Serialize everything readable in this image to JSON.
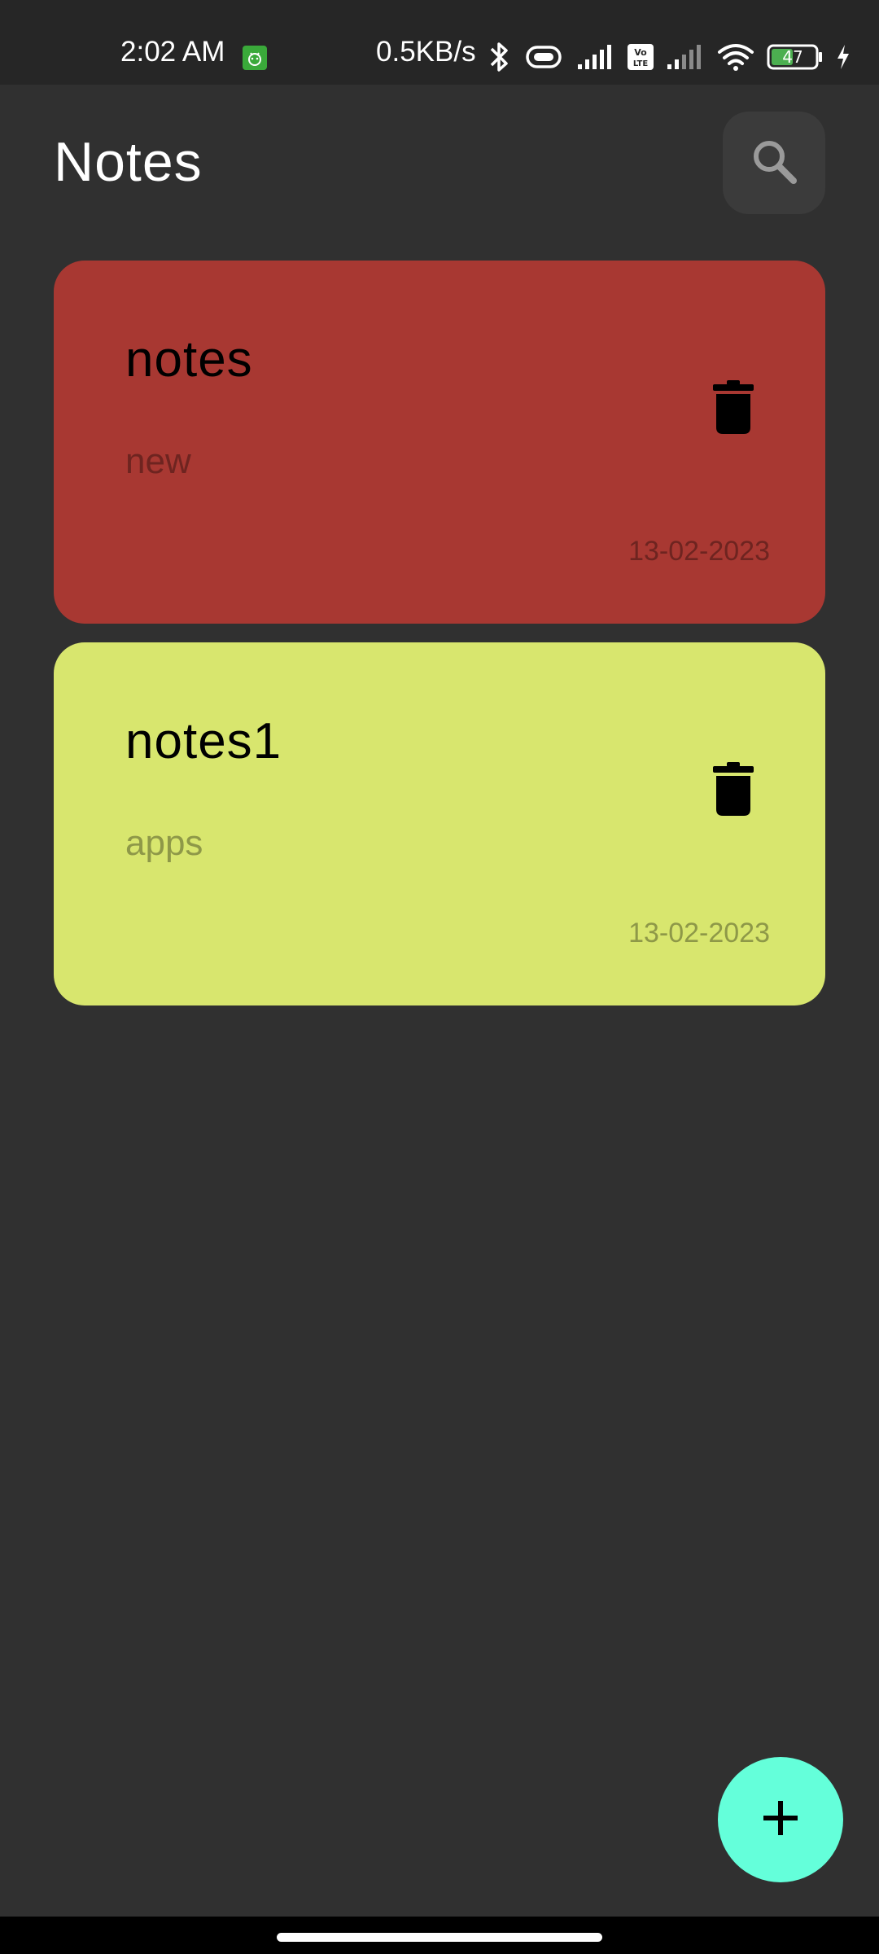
{
  "status_bar": {
    "time": "2:02 AM",
    "speed": "0.5KB/s",
    "battery": "47",
    "volte_label": "Vo LTE",
    "icons": [
      "app-notification-icon",
      "bluetooth-icon",
      "vibrate-icon",
      "signal-icon",
      "volte-icon",
      "signal-icon",
      "wifi-icon",
      "battery-icon",
      "charging-icon"
    ]
  },
  "header": {
    "title": "Notes",
    "search_icon": "search-icon"
  },
  "notes": [
    {
      "title": "notes",
      "body": "new",
      "date": "13-02-2023",
      "color": "#a83832",
      "body_color": "#6e2420",
      "date_color": "#6e2420"
    },
    {
      "title": "notes1",
      "body": "apps",
      "date": "13-02-2023",
      "color": "#d8e66e",
      "body_color": "#8e9848",
      "date_color": "#8e9848"
    }
  ],
  "fab": {
    "icon": "plus-icon",
    "color": "#64ffda"
  },
  "colors": {
    "background": "#303030",
    "status_bar": "#262626",
    "search_button": "#3b3b3b"
  }
}
